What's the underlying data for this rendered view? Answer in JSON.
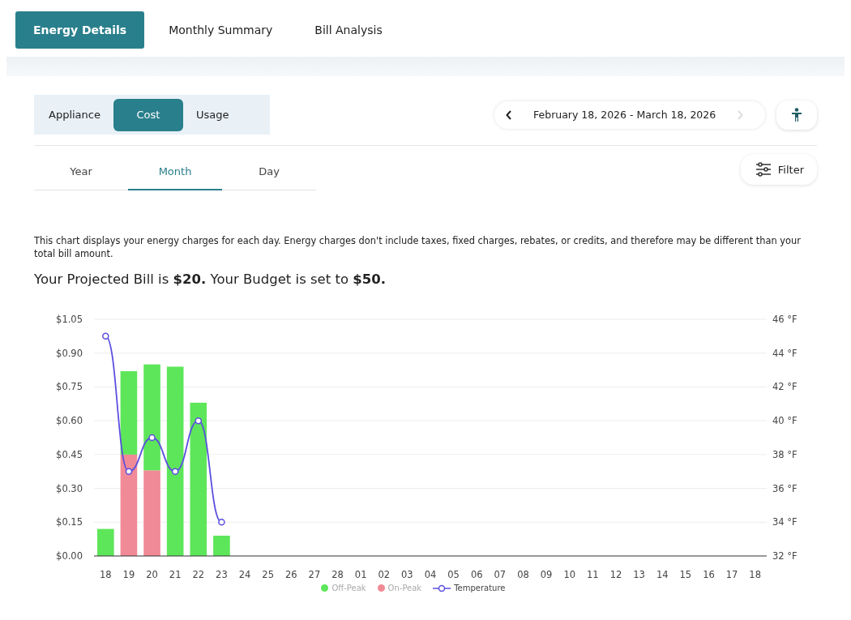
{
  "tabs": [
    {
      "label": "Energy Details",
      "selected": true
    },
    {
      "label": "Monthly Summary",
      "selected": false
    },
    {
      "label": "Bill Analysis",
      "selected": false
    }
  ],
  "view_toggle": [
    {
      "label": "Appliance",
      "selected": false
    },
    {
      "label": "Cost",
      "selected": true
    },
    {
      "label": "Usage",
      "selected": false
    }
  ],
  "date_range": {
    "label": "February 18, 2026 - March 18, 2026"
  },
  "period_tabs": [
    {
      "label": "Year",
      "selected": false
    },
    {
      "label": "Month",
      "selected": true
    },
    {
      "label": "Day",
      "selected": false
    }
  ],
  "filter_button": {
    "label": "Filter"
  },
  "description": "This chart displays your energy charges for each day. Energy charges don't include taxes, fixed charges, rebates, or credits, and therefore may be different than your total bill amount.",
  "projected_bill": "Your Projected Bill is **$20.** Your Budget is set to **$50.**",
  "chart": {
    "chart_data": {
      "type": "bar",
      "stacked": true,
      "grid": true,
      "categories": [
        "18",
        "19",
        "20",
        "21",
        "22",
        "23",
        "24",
        "25",
        "26",
        "27",
        "28",
        "01",
        "02",
        "03",
        "04",
        "05",
        "06",
        "07",
        "08",
        "09",
        "10",
        "11",
        "12",
        "13",
        "14",
        "15",
        "16",
        "17",
        "18"
      ],
      "series": [
        {
          "name": "Off-Peak",
          "color": "#5ee65a",
          "values": [
            0.12,
            0.37,
            0.47,
            0.84,
            0.68,
            0.09,
            null,
            null,
            null,
            null,
            null,
            null,
            null,
            null,
            null,
            null,
            null,
            null,
            null,
            null,
            null,
            null,
            null,
            null,
            null,
            null,
            null,
            null,
            null
          ]
        },
        {
          "name": "On-Peak",
          "color": "#f08a96",
          "values": [
            0,
            0.45,
            0.38,
            0,
            0,
            0,
            null,
            null,
            null,
            null,
            null,
            null,
            null,
            null,
            null,
            null,
            null,
            null,
            null,
            null,
            null,
            null,
            null,
            null,
            null,
            null,
            null,
            null,
            null
          ]
        },
        {
          "name": "Temperature",
          "color": "#5b4fe0",
          "type": "line",
          "axis": "y2",
          "marker": "circle",
          "values": [
            45,
            37,
            39,
            37,
            40,
            34,
            null,
            null,
            null,
            null,
            null,
            null,
            null,
            null,
            null,
            null,
            null,
            null,
            null,
            null,
            null,
            null,
            null,
            null,
            null,
            null,
            null,
            null,
            null
          ]
        }
      ],
      "ylim": [
        0,
        1.05
      ],
      "yticks": [
        {
          "value": 0,
          "label": "$0.00"
        },
        {
          "value": 0.15,
          "label": "$0.15"
        },
        {
          "value": 0.3,
          "label": "$0.30"
        },
        {
          "value": 0.45,
          "label": "$0.45"
        },
        {
          "value": 0.6,
          "label": "$0.60"
        },
        {
          "value": 0.75,
          "label": "$0.75"
        },
        {
          "value": 0.9,
          "label": "$0.90"
        },
        {
          "value": 1.05,
          "label": "$1.05"
        }
      ],
      "y2lim": [
        32,
        46
      ],
      "y2ticks": [
        {
          "value": 32,
          "label": "32 °F"
        },
        {
          "value": 34,
          "label": "34 °F"
        },
        {
          "value": 36,
          "label": "36 °F"
        },
        {
          "value": 38,
          "label": "38 °F"
        },
        {
          "value": 40,
          "label": "40 °F"
        },
        {
          "value": 42,
          "label": "42 °F"
        },
        {
          "value": 44,
          "label": "44 °F"
        },
        {
          "value": 46,
          "label": "46 °F"
        }
      ]
    }
  }
}
